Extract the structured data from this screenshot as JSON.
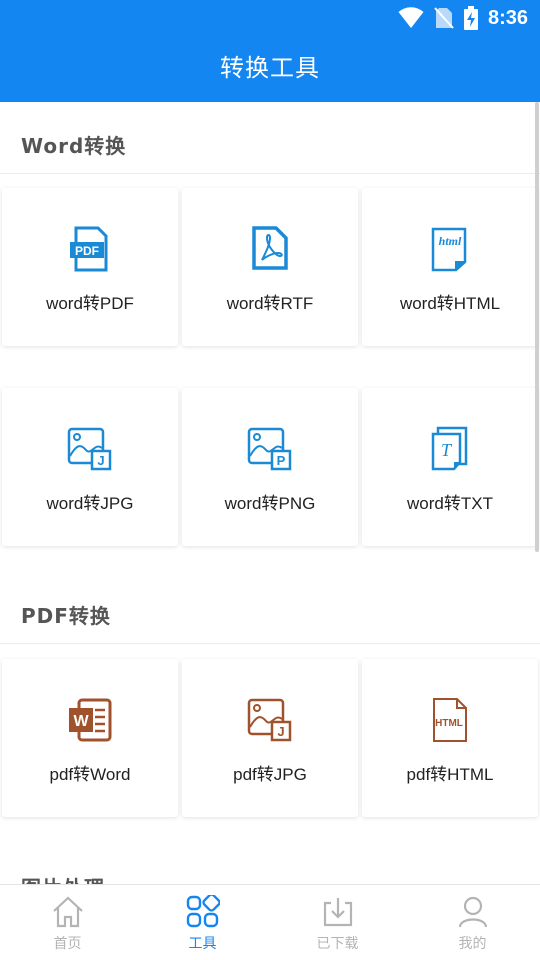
{
  "status": {
    "time": "8:36"
  },
  "header": {
    "title": "转换工具"
  },
  "sections": [
    {
      "title": "Word转换"
    },
    {
      "title": "PDF转换"
    },
    {
      "title": "图片处理"
    }
  ],
  "word_tools": [
    {
      "label": "word转PDF",
      "icon": "pdf-file-icon"
    },
    {
      "label": "word转RTF",
      "icon": "acrobat-file-icon"
    },
    {
      "label": "word转HTML",
      "icon": "html-file-icon"
    },
    {
      "label": "word转JPG",
      "icon": "image-jpg-icon"
    },
    {
      "label": "word转PNG",
      "icon": "image-png-icon"
    },
    {
      "label": "word转TXT",
      "icon": "text-file-icon"
    }
  ],
  "pdf_tools": [
    {
      "label": "pdf转Word",
      "icon": "word-file-icon"
    },
    {
      "label": "pdf转JPG",
      "icon": "image-jpg-icon"
    },
    {
      "label": "pdf转HTML",
      "icon": "html-file-icon"
    }
  ],
  "bottom_nav": [
    {
      "label": "首页",
      "icon": "home-icon",
      "active": false
    },
    {
      "label": "工具",
      "icon": "tools-grid-icon",
      "active": true
    },
    {
      "label": "已下载",
      "icon": "download-icon",
      "active": false
    },
    {
      "label": "我的",
      "icon": "profile-icon",
      "active": false
    }
  ],
  "colors": {
    "primary": "#1486f2",
    "word_icon": "#1a8ad6",
    "pdf_icon": "#a0522d",
    "inactive": "#b4b4b4"
  }
}
